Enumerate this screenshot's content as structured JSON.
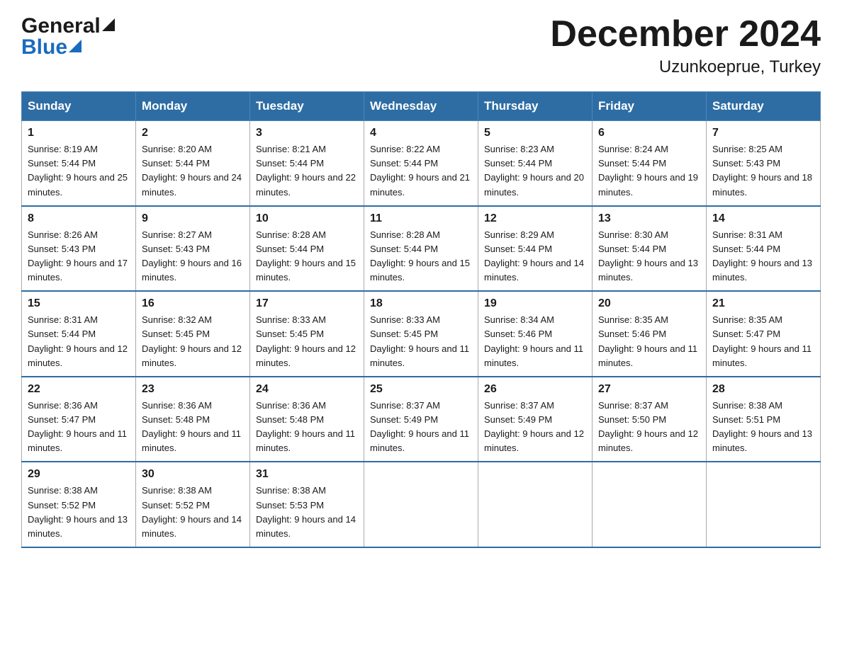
{
  "header": {
    "logo_general": "General",
    "logo_blue": "Blue",
    "title": "December 2024",
    "subtitle": "Uzunkoeprue, Turkey"
  },
  "days_of_week": [
    "Sunday",
    "Monday",
    "Tuesday",
    "Wednesday",
    "Thursday",
    "Friday",
    "Saturday"
  ],
  "weeks": [
    [
      {
        "day": "1",
        "sunrise": "8:19 AM",
        "sunset": "5:44 PM",
        "daylight": "9 hours and 25 minutes."
      },
      {
        "day": "2",
        "sunrise": "8:20 AM",
        "sunset": "5:44 PM",
        "daylight": "9 hours and 24 minutes."
      },
      {
        "day": "3",
        "sunrise": "8:21 AM",
        "sunset": "5:44 PM",
        "daylight": "9 hours and 22 minutes."
      },
      {
        "day": "4",
        "sunrise": "8:22 AM",
        "sunset": "5:44 PM",
        "daylight": "9 hours and 21 minutes."
      },
      {
        "day": "5",
        "sunrise": "8:23 AM",
        "sunset": "5:44 PM",
        "daylight": "9 hours and 20 minutes."
      },
      {
        "day": "6",
        "sunrise": "8:24 AM",
        "sunset": "5:44 PM",
        "daylight": "9 hours and 19 minutes."
      },
      {
        "day": "7",
        "sunrise": "8:25 AM",
        "sunset": "5:43 PM",
        "daylight": "9 hours and 18 minutes."
      }
    ],
    [
      {
        "day": "8",
        "sunrise": "8:26 AM",
        "sunset": "5:43 PM",
        "daylight": "9 hours and 17 minutes."
      },
      {
        "day": "9",
        "sunrise": "8:27 AM",
        "sunset": "5:43 PM",
        "daylight": "9 hours and 16 minutes."
      },
      {
        "day": "10",
        "sunrise": "8:28 AM",
        "sunset": "5:44 PM",
        "daylight": "9 hours and 15 minutes."
      },
      {
        "day": "11",
        "sunrise": "8:28 AM",
        "sunset": "5:44 PM",
        "daylight": "9 hours and 15 minutes."
      },
      {
        "day": "12",
        "sunrise": "8:29 AM",
        "sunset": "5:44 PM",
        "daylight": "9 hours and 14 minutes."
      },
      {
        "day": "13",
        "sunrise": "8:30 AM",
        "sunset": "5:44 PM",
        "daylight": "9 hours and 13 minutes."
      },
      {
        "day": "14",
        "sunrise": "8:31 AM",
        "sunset": "5:44 PM",
        "daylight": "9 hours and 13 minutes."
      }
    ],
    [
      {
        "day": "15",
        "sunrise": "8:31 AM",
        "sunset": "5:44 PM",
        "daylight": "9 hours and 12 minutes."
      },
      {
        "day": "16",
        "sunrise": "8:32 AM",
        "sunset": "5:45 PM",
        "daylight": "9 hours and 12 minutes."
      },
      {
        "day": "17",
        "sunrise": "8:33 AM",
        "sunset": "5:45 PM",
        "daylight": "9 hours and 12 minutes."
      },
      {
        "day": "18",
        "sunrise": "8:33 AM",
        "sunset": "5:45 PM",
        "daylight": "9 hours and 11 minutes."
      },
      {
        "day": "19",
        "sunrise": "8:34 AM",
        "sunset": "5:46 PM",
        "daylight": "9 hours and 11 minutes."
      },
      {
        "day": "20",
        "sunrise": "8:35 AM",
        "sunset": "5:46 PM",
        "daylight": "9 hours and 11 minutes."
      },
      {
        "day": "21",
        "sunrise": "8:35 AM",
        "sunset": "5:47 PM",
        "daylight": "9 hours and 11 minutes."
      }
    ],
    [
      {
        "day": "22",
        "sunrise": "8:36 AM",
        "sunset": "5:47 PM",
        "daylight": "9 hours and 11 minutes."
      },
      {
        "day": "23",
        "sunrise": "8:36 AM",
        "sunset": "5:48 PM",
        "daylight": "9 hours and 11 minutes."
      },
      {
        "day": "24",
        "sunrise": "8:36 AM",
        "sunset": "5:48 PM",
        "daylight": "9 hours and 11 minutes."
      },
      {
        "day": "25",
        "sunrise": "8:37 AM",
        "sunset": "5:49 PM",
        "daylight": "9 hours and 11 minutes."
      },
      {
        "day": "26",
        "sunrise": "8:37 AM",
        "sunset": "5:49 PM",
        "daylight": "9 hours and 12 minutes."
      },
      {
        "day": "27",
        "sunrise": "8:37 AM",
        "sunset": "5:50 PM",
        "daylight": "9 hours and 12 minutes."
      },
      {
        "day": "28",
        "sunrise": "8:38 AM",
        "sunset": "5:51 PM",
        "daylight": "9 hours and 13 minutes."
      }
    ],
    [
      {
        "day": "29",
        "sunrise": "8:38 AM",
        "sunset": "5:52 PM",
        "daylight": "9 hours and 13 minutes."
      },
      {
        "day": "30",
        "sunrise": "8:38 AM",
        "sunset": "5:52 PM",
        "daylight": "9 hours and 14 minutes."
      },
      {
        "day": "31",
        "sunrise": "8:38 AM",
        "sunset": "5:53 PM",
        "daylight": "9 hours and 14 minutes."
      },
      null,
      null,
      null,
      null
    ]
  ],
  "labels": {
    "sunrise_prefix": "Sunrise: ",
    "sunset_prefix": "Sunset: ",
    "daylight_prefix": "Daylight: "
  }
}
